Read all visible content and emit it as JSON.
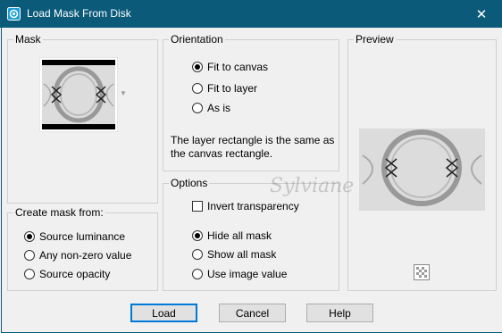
{
  "window": {
    "title": "Load Mask From Disk",
    "close_glyph": "✕"
  },
  "mask_group": {
    "legend": "Mask"
  },
  "create_group": {
    "legend": "Create mask from:",
    "options": [
      {
        "label": "Source luminance",
        "selected": true
      },
      {
        "label": "Any non-zero value",
        "selected": false
      },
      {
        "label": "Source opacity",
        "selected": false
      }
    ]
  },
  "orientation_group": {
    "legend": "Orientation",
    "options": [
      {
        "label": "Fit to canvas",
        "selected": true
      },
      {
        "label": "Fit to layer",
        "selected": false
      },
      {
        "label": "As is",
        "selected": false
      }
    ],
    "note": "The layer rectangle is the same as the canvas rectangle."
  },
  "options_group": {
    "legend": "Options",
    "invert_label": "Invert transparency",
    "invert_checked": false,
    "options": [
      {
        "label": "Hide all mask",
        "selected": true
      },
      {
        "label": "Show all mask",
        "selected": false
      },
      {
        "label": "Use image value",
        "selected": false
      }
    ]
  },
  "preview_group": {
    "legend": "Preview"
  },
  "watermark": "Sylviane",
  "buttons": {
    "load": "Load",
    "cancel": "Cancel",
    "help": "Help"
  },
  "colors": {
    "titlebar": "#0b5a7a",
    "accent": "#0078d7"
  }
}
